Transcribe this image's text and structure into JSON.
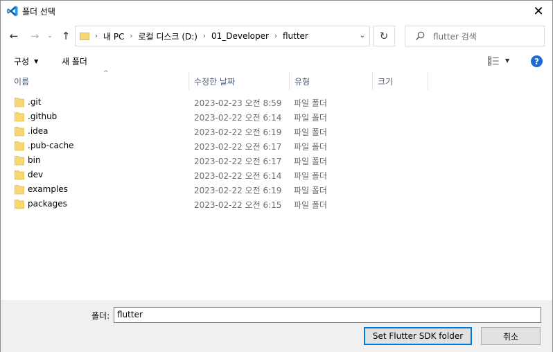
{
  "window": {
    "title": "폴더 선택",
    "close_glyph": "✕"
  },
  "nav": {
    "back_glyph": "←",
    "forward_glyph": "→",
    "recent_glyph": "⌄",
    "up_glyph": "↑",
    "breadcrumbs": [
      "내 PC",
      "로컬 디스크 (D:)",
      "01_Developer",
      "flutter"
    ],
    "crumb_sep_glyph": "›",
    "dropdown_glyph": "⌄",
    "refresh_glyph": "↻",
    "search_placeholder": "flutter 검색"
  },
  "toolbar": {
    "organize_label": "구성",
    "organize_caret": "▼",
    "new_folder_label": "새 폴더",
    "view_caret": "▼",
    "help_glyph": "?"
  },
  "columns": {
    "name": "이름",
    "date": "수정한 날짜",
    "type": "유형",
    "size": "크기",
    "sort_glyph": "^"
  },
  "files": [
    {
      "name": ".git",
      "date": "2023-02-23 오전 8:59",
      "type": "파일 폴더"
    },
    {
      "name": ".github",
      "date": "2023-02-22 오전 6:14",
      "type": "파일 폴더"
    },
    {
      "name": ".idea",
      "date": "2023-02-22 오전 6:19",
      "type": "파일 폴더"
    },
    {
      "name": ".pub-cache",
      "date": "2023-02-22 오전 6:17",
      "type": "파일 폴더"
    },
    {
      "name": "bin",
      "date": "2023-02-22 오전 6:17",
      "type": "파일 폴더"
    },
    {
      "name": "dev",
      "date": "2023-02-22 오전 6:14",
      "type": "파일 폴더"
    },
    {
      "name": "examples",
      "date": "2023-02-22 오전 6:19",
      "type": "파일 폴더"
    },
    {
      "name": "packages",
      "date": "2023-02-22 오전 6:15",
      "type": "파일 폴더"
    }
  ],
  "footer": {
    "folder_label": "폴더:",
    "folder_value": "flutter",
    "primary_button": "Set Flutter SDK folder",
    "cancel_button": "취소"
  },
  "colors": {
    "accent": "#0078d7",
    "help_blue": "#1c6ad0",
    "folder_yellow": "#f8d775",
    "vscode_blue": "#0065a9"
  }
}
